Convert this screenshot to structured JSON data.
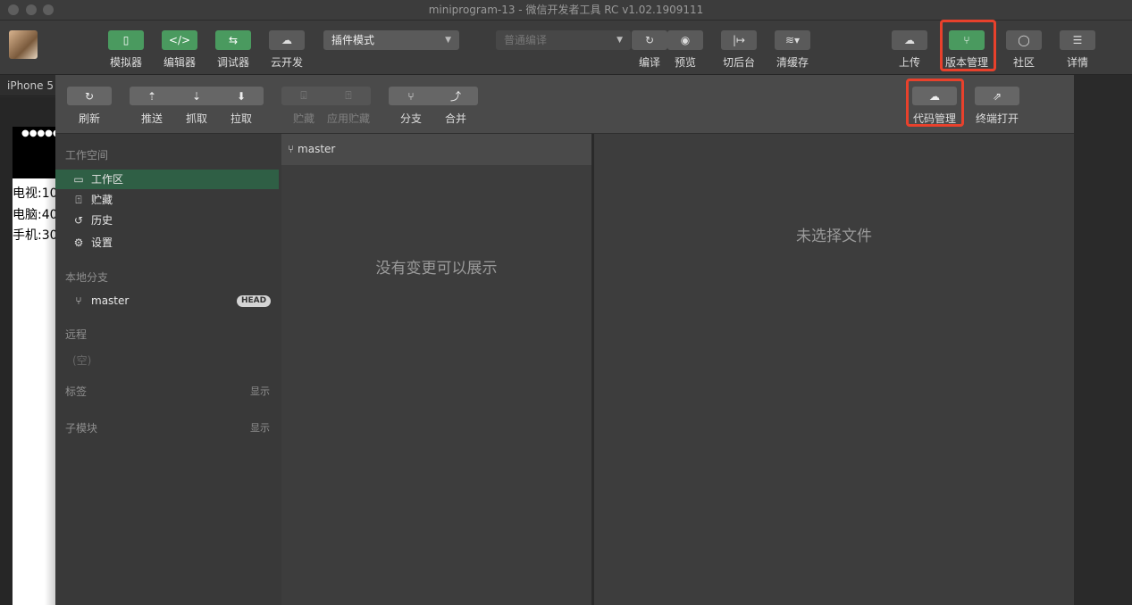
{
  "window": {
    "title": "miniprogram-13 - 微信开发者工具 RC v1.02.1909111"
  },
  "toolbar": {
    "simulator": "模拟器",
    "editor": "编辑器",
    "debugger": "调试器",
    "cloud_dev": "云开发",
    "mode_select": "插件模式",
    "compile_select": "普通编译",
    "compile": "编译",
    "preview": "预览",
    "background": "切后台",
    "clear_cache": "清缓存",
    "upload": "上传",
    "version_mgmt": "版本管理",
    "community": "社区",
    "details": "详情"
  },
  "device": {
    "name": "iPhone 5"
  },
  "phone": {
    "status": "●●●●●",
    "lines": [
      "电视:10",
      "电脑:40",
      "手机:30"
    ]
  },
  "vc_toolbar": {
    "refresh": "刷新",
    "push": "推送",
    "fetch": "抓取",
    "pull": "拉取",
    "stash": "贮藏",
    "apply_stash": "应用贮藏",
    "branch": "分支",
    "merge": "合并",
    "code_mgmt": "代码管理",
    "open_terminal": "终端打开"
  },
  "sidebar": {
    "workspace_header": "工作空间",
    "items": [
      {
        "label": "工作区",
        "icon": "folder-icon"
      },
      {
        "label": "贮藏",
        "icon": "stash-icon"
      },
      {
        "label": "历史",
        "icon": "history-icon"
      },
      {
        "label": "设置",
        "icon": "gear-icon"
      }
    ],
    "local_branch_header": "本地分支",
    "branch": "master",
    "head_badge": "HEAD",
    "remote_header": "远程",
    "remote_empty": "(空)",
    "tags_header": "标签",
    "tags_show": "显示",
    "submodule_header": "子模块",
    "submodule_show": "显示"
  },
  "changes": {
    "branch": "master",
    "empty": "没有变更可以展示"
  },
  "diff": {
    "empty": "未选择文件"
  },
  "colors": {
    "accent_green": "#4a9a5f",
    "highlight_red": "#e8412c",
    "active_row": "#2f5f45"
  }
}
